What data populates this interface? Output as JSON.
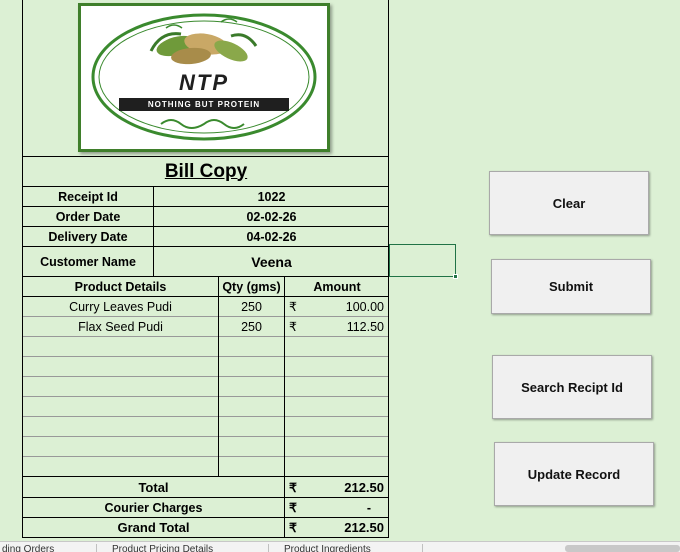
{
  "logo": {
    "brand": "NTP",
    "tagline": "NOTHING BUT PROTEIN"
  },
  "bill": {
    "title": "Bill Copy",
    "receipt_id_label": "Receipt Id",
    "receipt_id": "1022",
    "order_date_label": "Order Date",
    "order_date": "02-02-26",
    "delivery_date_label": "Delivery Date",
    "delivery_date": "04-02-26",
    "customer_name_label": "Customer Name",
    "customer_name": "Veena",
    "headers": {
      "product": "Product Details",
      "qty": "Qty (gms)",
      "amount": "Amount"
    },
    "items": [
      {
        "product": "Curry Leaves Pudi",
        "qty": "250",
        "currency": "₹",
        "amount": "100.00"
      },
      {
        "product": "Flax Seed Pudi",
        "qty": "250",
        "currency": "₹",
        "amount": "112.50"
      }
    ],
    "total_label": "Total",
    "total_currency": "₹",
    "total": "212.50",
    "courier_label": "Courier Charges",
    "courier_currency": "₹",
    "courier": "-",
    "grand_total_label": "Grand Total",
    "grand_total_currency": "₹",
    "grand_total": "212.50"
  },
  "buttons": {
    "clear": "Clear",
    "submit": "Submit",
    "search": "Search Recipt Id",
    "update": "Update Record"
  },
  "sheet_tabs": [
    "ding Orders",
    "Product Pricing Details",
    "Product Ingredients"
  ]
}
